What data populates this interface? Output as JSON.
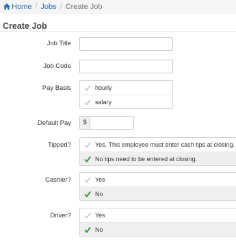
{
  "breadcrumb": {
    "home": "Home",
    "jobs": "Jobs",
    "current": "Create Job"
  },
  "page": {
    "title": "Create Job"
  },
  "form": {
    "job_title": {
      "label": "Job Title",
      "value": ""
    },
    "job_code": {
      "label": "Job Code",
      "value": ""
    },
    "pay_basis": {
      "label": "Pay Basis",
      "options": [
        "hourly",
        "salary"
      ]
    },
    "default_pay": {
      "label": "Default Pay",
      "prefix": "$",
      "value": ""
    },
    "tipped": {
      "label": "Tipped?",
      "options": [
        "Yes. This employee must enter cash tips at closing.",
        "No tips need to be entered at closing."
      ],
      "selected": "No tips need to be entered at closing."
    },
    "cashier": {
      "label": "Cashier?",
      "options": [
        "Yes",
        "No"
      ],
      "selected": "No"
    },
    "driver": {
      "label": "Driver?",
      "options": [
        "Yes",
        "No"
      ],
      "selected": "No"
    }
  },
  "colors": {
    "link": "#2a6fb5",
    "check_active": "#3a9a3a",
    "check_inactive": "#c8c8c8"
  }
}
